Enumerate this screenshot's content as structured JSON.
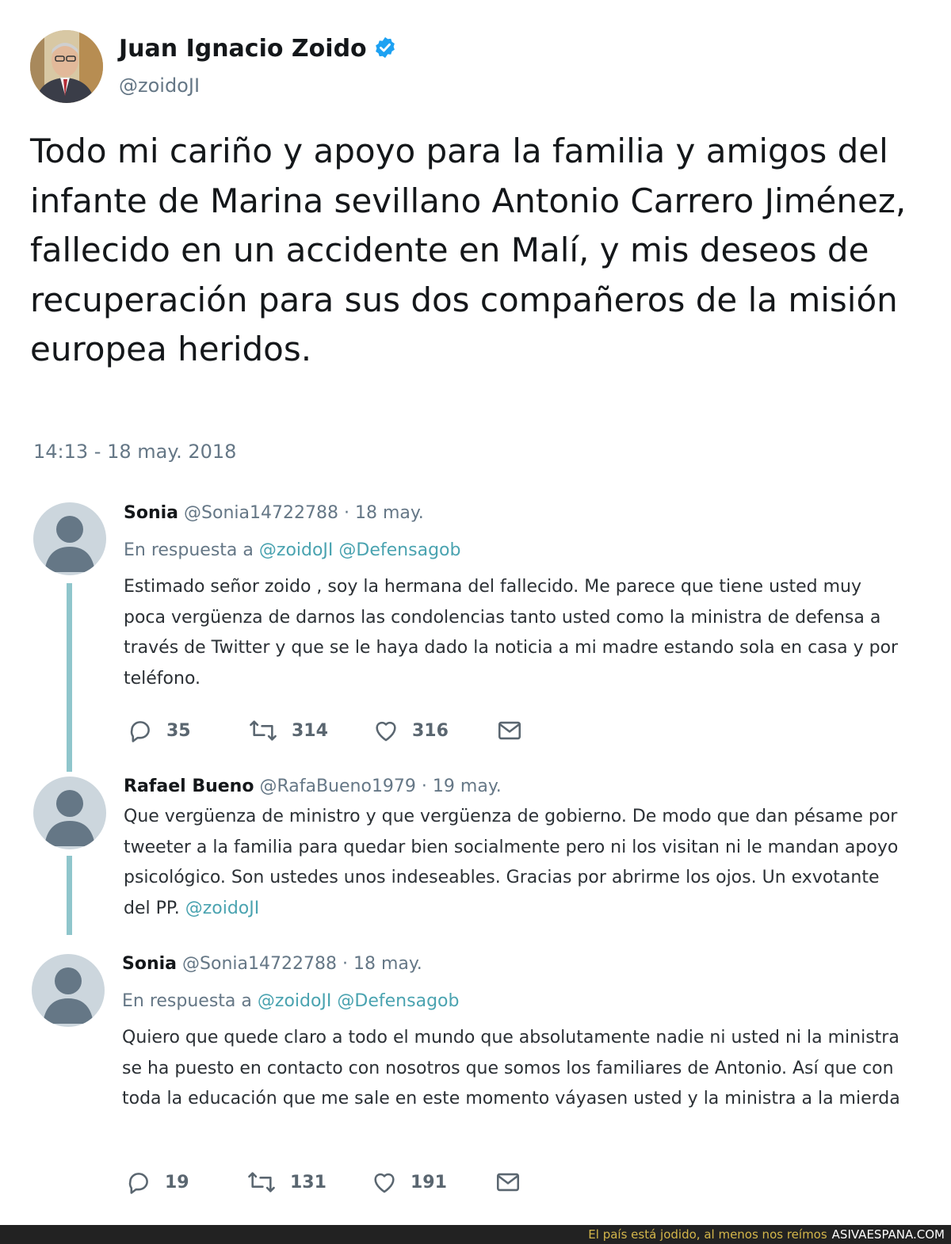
{
  "main_tweet": {
    "author_name": "Juan Ignacio Zoido",
    "author_handle": "@zoidoJI",
    "verified": true,
    "text": "Todo mi cariño y apoyo para la familia y amigos del infante de Marina sevillano Antonio Carrero Jiménez, fallecido en un accidente en Malí, y mis deseos de recuperación para sus dos compañeros de la misión europea heridos.",
    "timestamp": "14:13 - 18 may. 2018"
  },
  "replies": [
    {
      "name": "Sonia",
      "handle": "@Sonia14722788",
      "separator": " · ",
      "date": "18 may.",
      "in_reply_prefix": "En respuesta a ",
      "in_reply_mention_1": "@zoidoJI",
      "in_reply_mention_2": "@Defensagob",
      "text": "Estimado señor zoido , soy la hermana del fallecido. Me parece que tiene usted muy poca vergüenza de darnos las condolencias tanto usted como la ministra de defensa a través de Twitter y que se le haya dado la noticia a mi madre estando sola en casa y por teléfono.",
      "replies_count": "35",
      "retweets_count": "314",
      "likes_count": "316"
    },
    {
      "name": "Rafael Bueno",
      "handle": "@RafaBueno1979",
      "separator": " · ",
      "date": "19 may.",
      "text": "Que vergüenza de ministro y que vergüenza de gobierno. De modo que dan pésame por tweeter a la familia para quedar bien socialmente pero ni los visitan ni le mandan apoyo psicológico. Son ustedes unos indeseables. Gracias por abrirme los ojos. Un exvotante del PP. ",
      "text_mention": "@zoidoJI"
    },
    {
      "name": "Sonia",
      "handle": "@Sonia14722788",
      "separator": " · ",
      "date": "18 may.",
      "in_reply_prefix": "En respuesta a ",
      "in_reply_mention_1": "@zoidoJI",
      "in_reply_mention_2": "@Defensagob",
      "text": "Quiero que quede claro a todo el mundo que absolutamente nadie ni usted ni la ministra se ha puesto en contacto con nosotros que somos los familiares de Antonio. Así que con toda la educación que me sale en este momento váyasen usted y la ministra a la mierda",
      "replies_count": "19",
      "retweets_count": "131",
      "likes_count": "191"
    }
  ],
  "footer": {
    "slogan": "El país está jodido, al menos nos reímos",
    "site": "ASIVAESPANA.COM"
  },
  "colors": {
    "accent_link": "#4aa3b0",
    "thread_line": "#8fc6cc",
    "verified_badge": "#1da1f2",
    "muted_text": "#657786"
  },
  "icons": {
    "reply": "reply-icon",
    "retweet": "retweet-icon",
    "like": "heart-icon",
    "dm": "envelope-icon",
    "verified": "verified-badge-icon"
  }
}
